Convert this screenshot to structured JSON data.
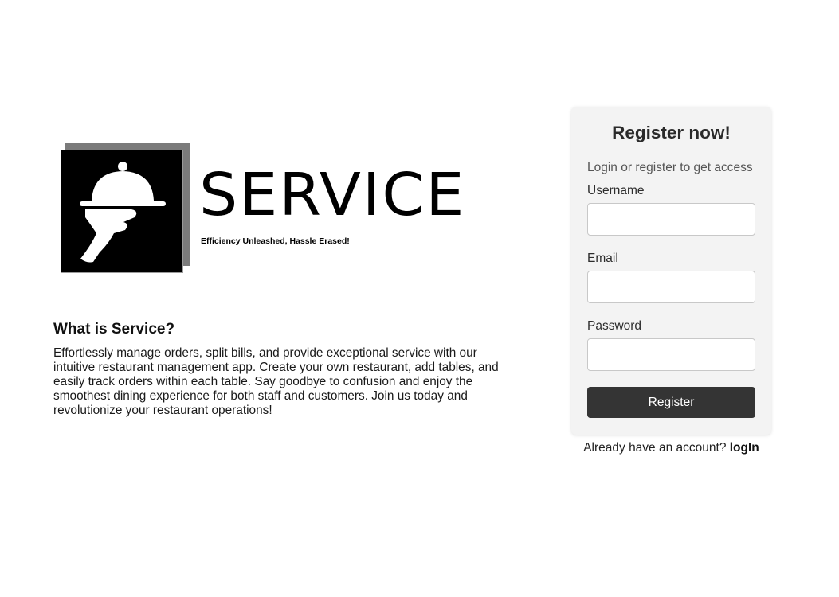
{
  "logo": {
    "wordmark": "SERVICE",
    "tagline": "Efficiency Unleashed, Hassle Erased!",
    "icon": "waiter-cloche-icon"
  },
  "about": {
    "title": "What is Service?",
    "text": "Effortlessly manage orders, split bills, and provide exceptional service with our intuitive restaurant management app. Create your own restaurant, add tables, and easily track orders within each table. Say goodbye to confusion and enjoy the smoothest dining experience for both staff and customers. Join us today and revolutionize your restaurant operations!"
  },
  "register": {
    "title": "Register now!",
    "subtitle": "Login or register to get access",
    "username_label": "Username",
    "username_value": "",
    "email_label": "Email",
    "email_value": "",
    "password_label": "Password",
    "password_value": "",
    "button_label": "Register"
  },
  "login": {
    "prompt": "Already have an account?",
    "link_label": "logIn"
  },
  "colors": {
    "card_background": "#f3f3f3",
    "button_background": "#343434",
    "button_text": "#ffffff",
    "logo_box": "#000000",
    "logo_shadow": "#7b7b7b"
  }
}
